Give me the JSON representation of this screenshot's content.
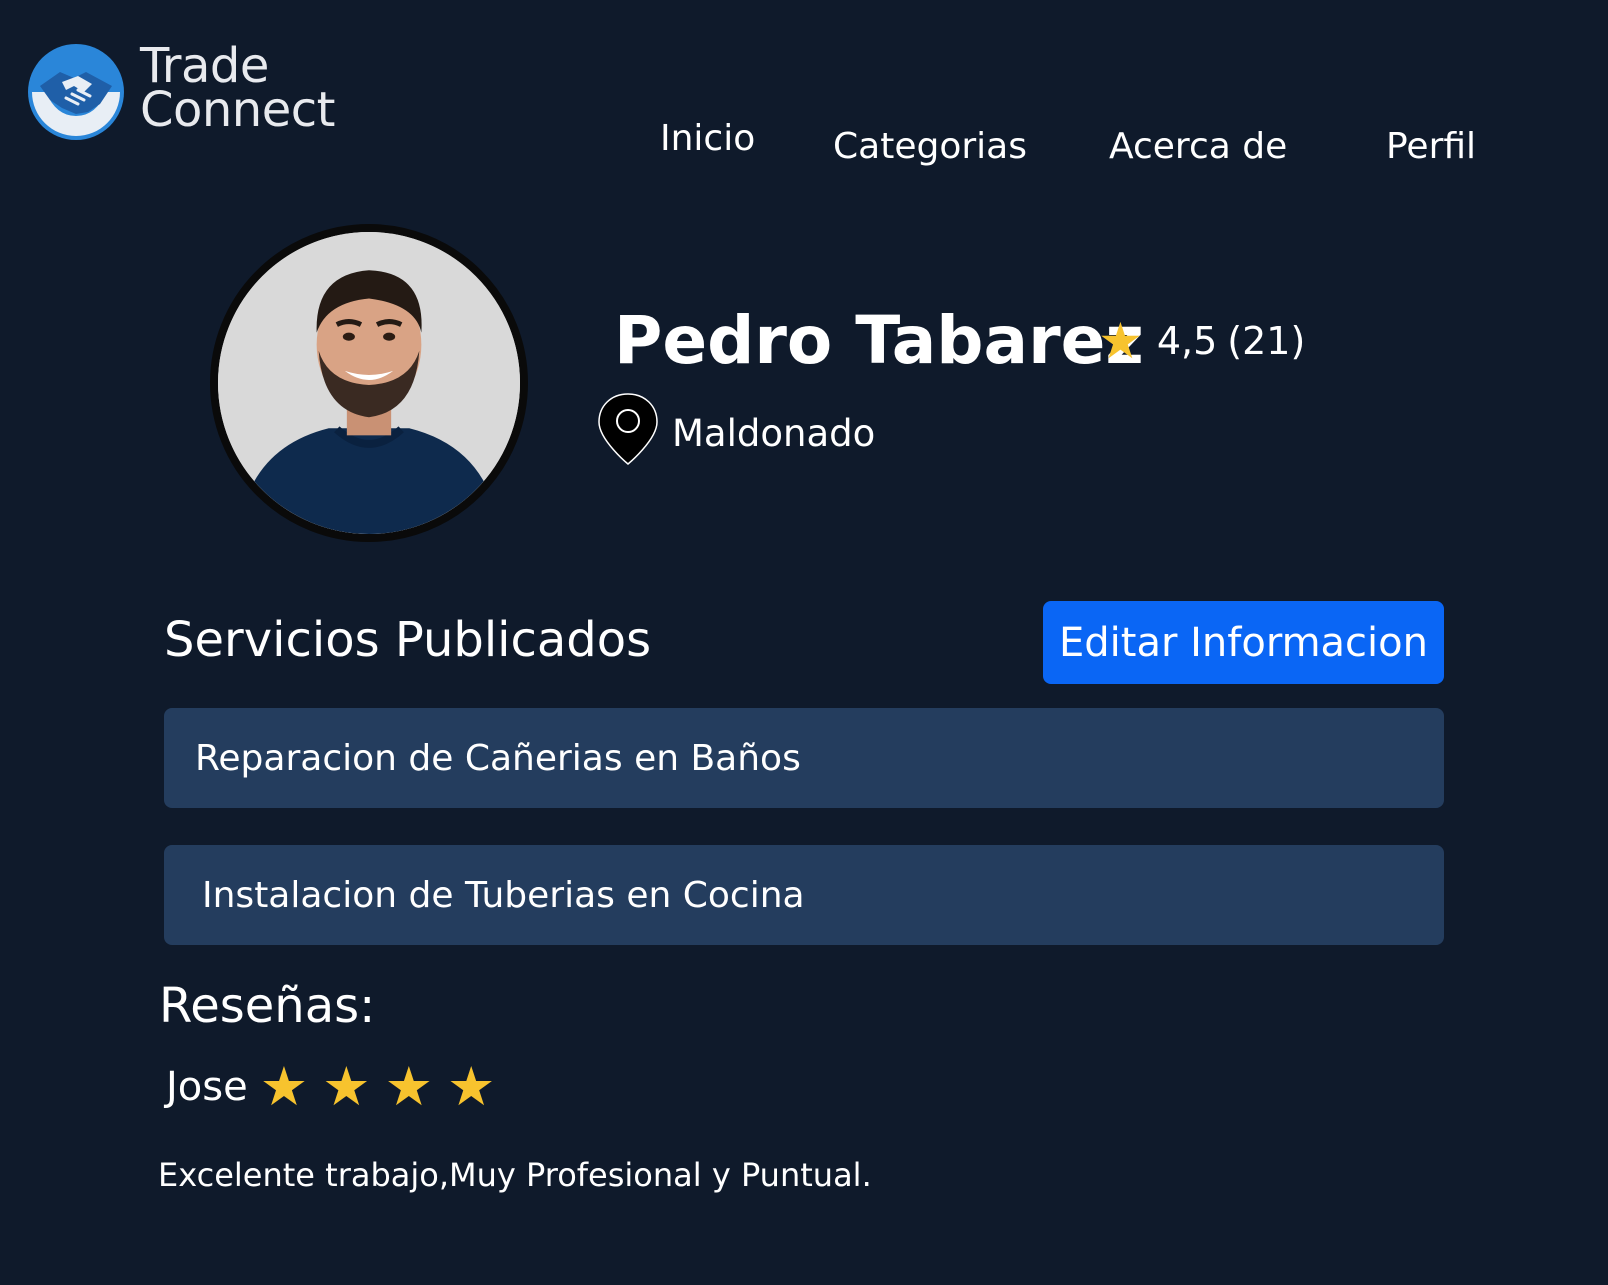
{
  "brand": {
    "line1": "Trade",
    "line2": "Connect",
    "icon": "handshake-icon",
    "colors": {
      "primary": "#2a86d9",
      "accent": "#1f5fa8"
    }
  },
  "nav": {
    "inicio": "Inicio",
    "categorias": "Categorias",
    "acerca": "Acerca de",
    "perfil": "Perfil"
  },
  "profile": {
    "name": "Pedro Tabarez",
    "rating_star": "★",
    "rating_value": "4,5",
    "rating_count": "(21)",
    "location_icon": "location-pin-icon",
    "location": "Maldonado"
  },
  "services": {
    "title": "Servicios Publicados",
    "edit_label": "Editar Informacion",
    "items": [
      {
        "label": "Reparacion de Cañerias en Baños"
      },
      {
        "label": "Instalacion de Tuberias en Cocina"
      }
    ]
  },
  "reviews": {
    "title": "Reseñas:",
    "items": [
      {
        "author": "Jose",
        "stars": 4,
        "star_glyph": "★",
        "text": "Excelente trabajo,Muy Profesional y Puntual."
      }
    ]
  },
  "colors": {
    "background": "#0f1a2b",
    "card": "#243d5e",
    "button": "#0a66f5",
    "star": "#f7c32e"
  }
}
